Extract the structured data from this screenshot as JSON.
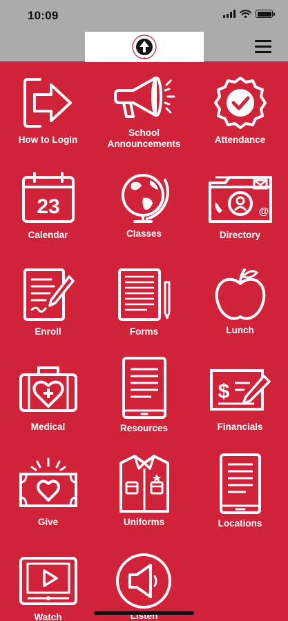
{
  "status_bar": {
    "time": "10:09"
  },
  "header": {
    "menu_icon": "hamburger-menu-icon",
    "logo_icon": "school-logo"
  },
  "tiles": [
    {
      "label": "How to Login",
      "icon": "login-arrow-icon"
    },
    {
      "label": "School Announcements",
      "icon": "megaphone-icon"
    },
    {
      "label": "Attendance",
      "icon": "checkmark-badge-icon"
    },
    {
      "label": "Calendar",
      "icon": "calendar-icon",
      "date": "23"
    },
    {
      "label": "Classes",
      "icon": "globe-icon"
    },
    {
      "label": "Directory",
      "icon": "contact-card-icon"
    },
    {
      "label": "Enroll",
      "icon": "document-pen-icon"
    },
    {
      "label": "Forms",
      "icon": "form-pencil-icon"
    },
    {
      "label": "Lunch",
      "icon": "apple-icon"
    },
    {
      "label": "Medical",
      "icon": "medical-kit-icon"
    },
    {
      "label": "Resources",
      "icon": "tablet-document-icon"
    },
    {
      "label": "Financials",
      "icon": "check-pen-icon"
    },
    {
      "label": "Give",
      "icon": "heart-money-icon"
    },
    {
      "label": "Uniforms",
      "icon": "shirt-icon"
    },
    {
      "label": "Locations",
      "icon": "phone-document-icon"
    },
    {
      "label": "Watch",
      "icon": "video-play-icon"
    },
    {
      "label": "Listen",
      "icon": "speaker-icon"
    }
  ],
  "colors": {
    "background": "#d0233a",
    "header": "#ababab",
    "icon": "#ffffff"
  }
}
